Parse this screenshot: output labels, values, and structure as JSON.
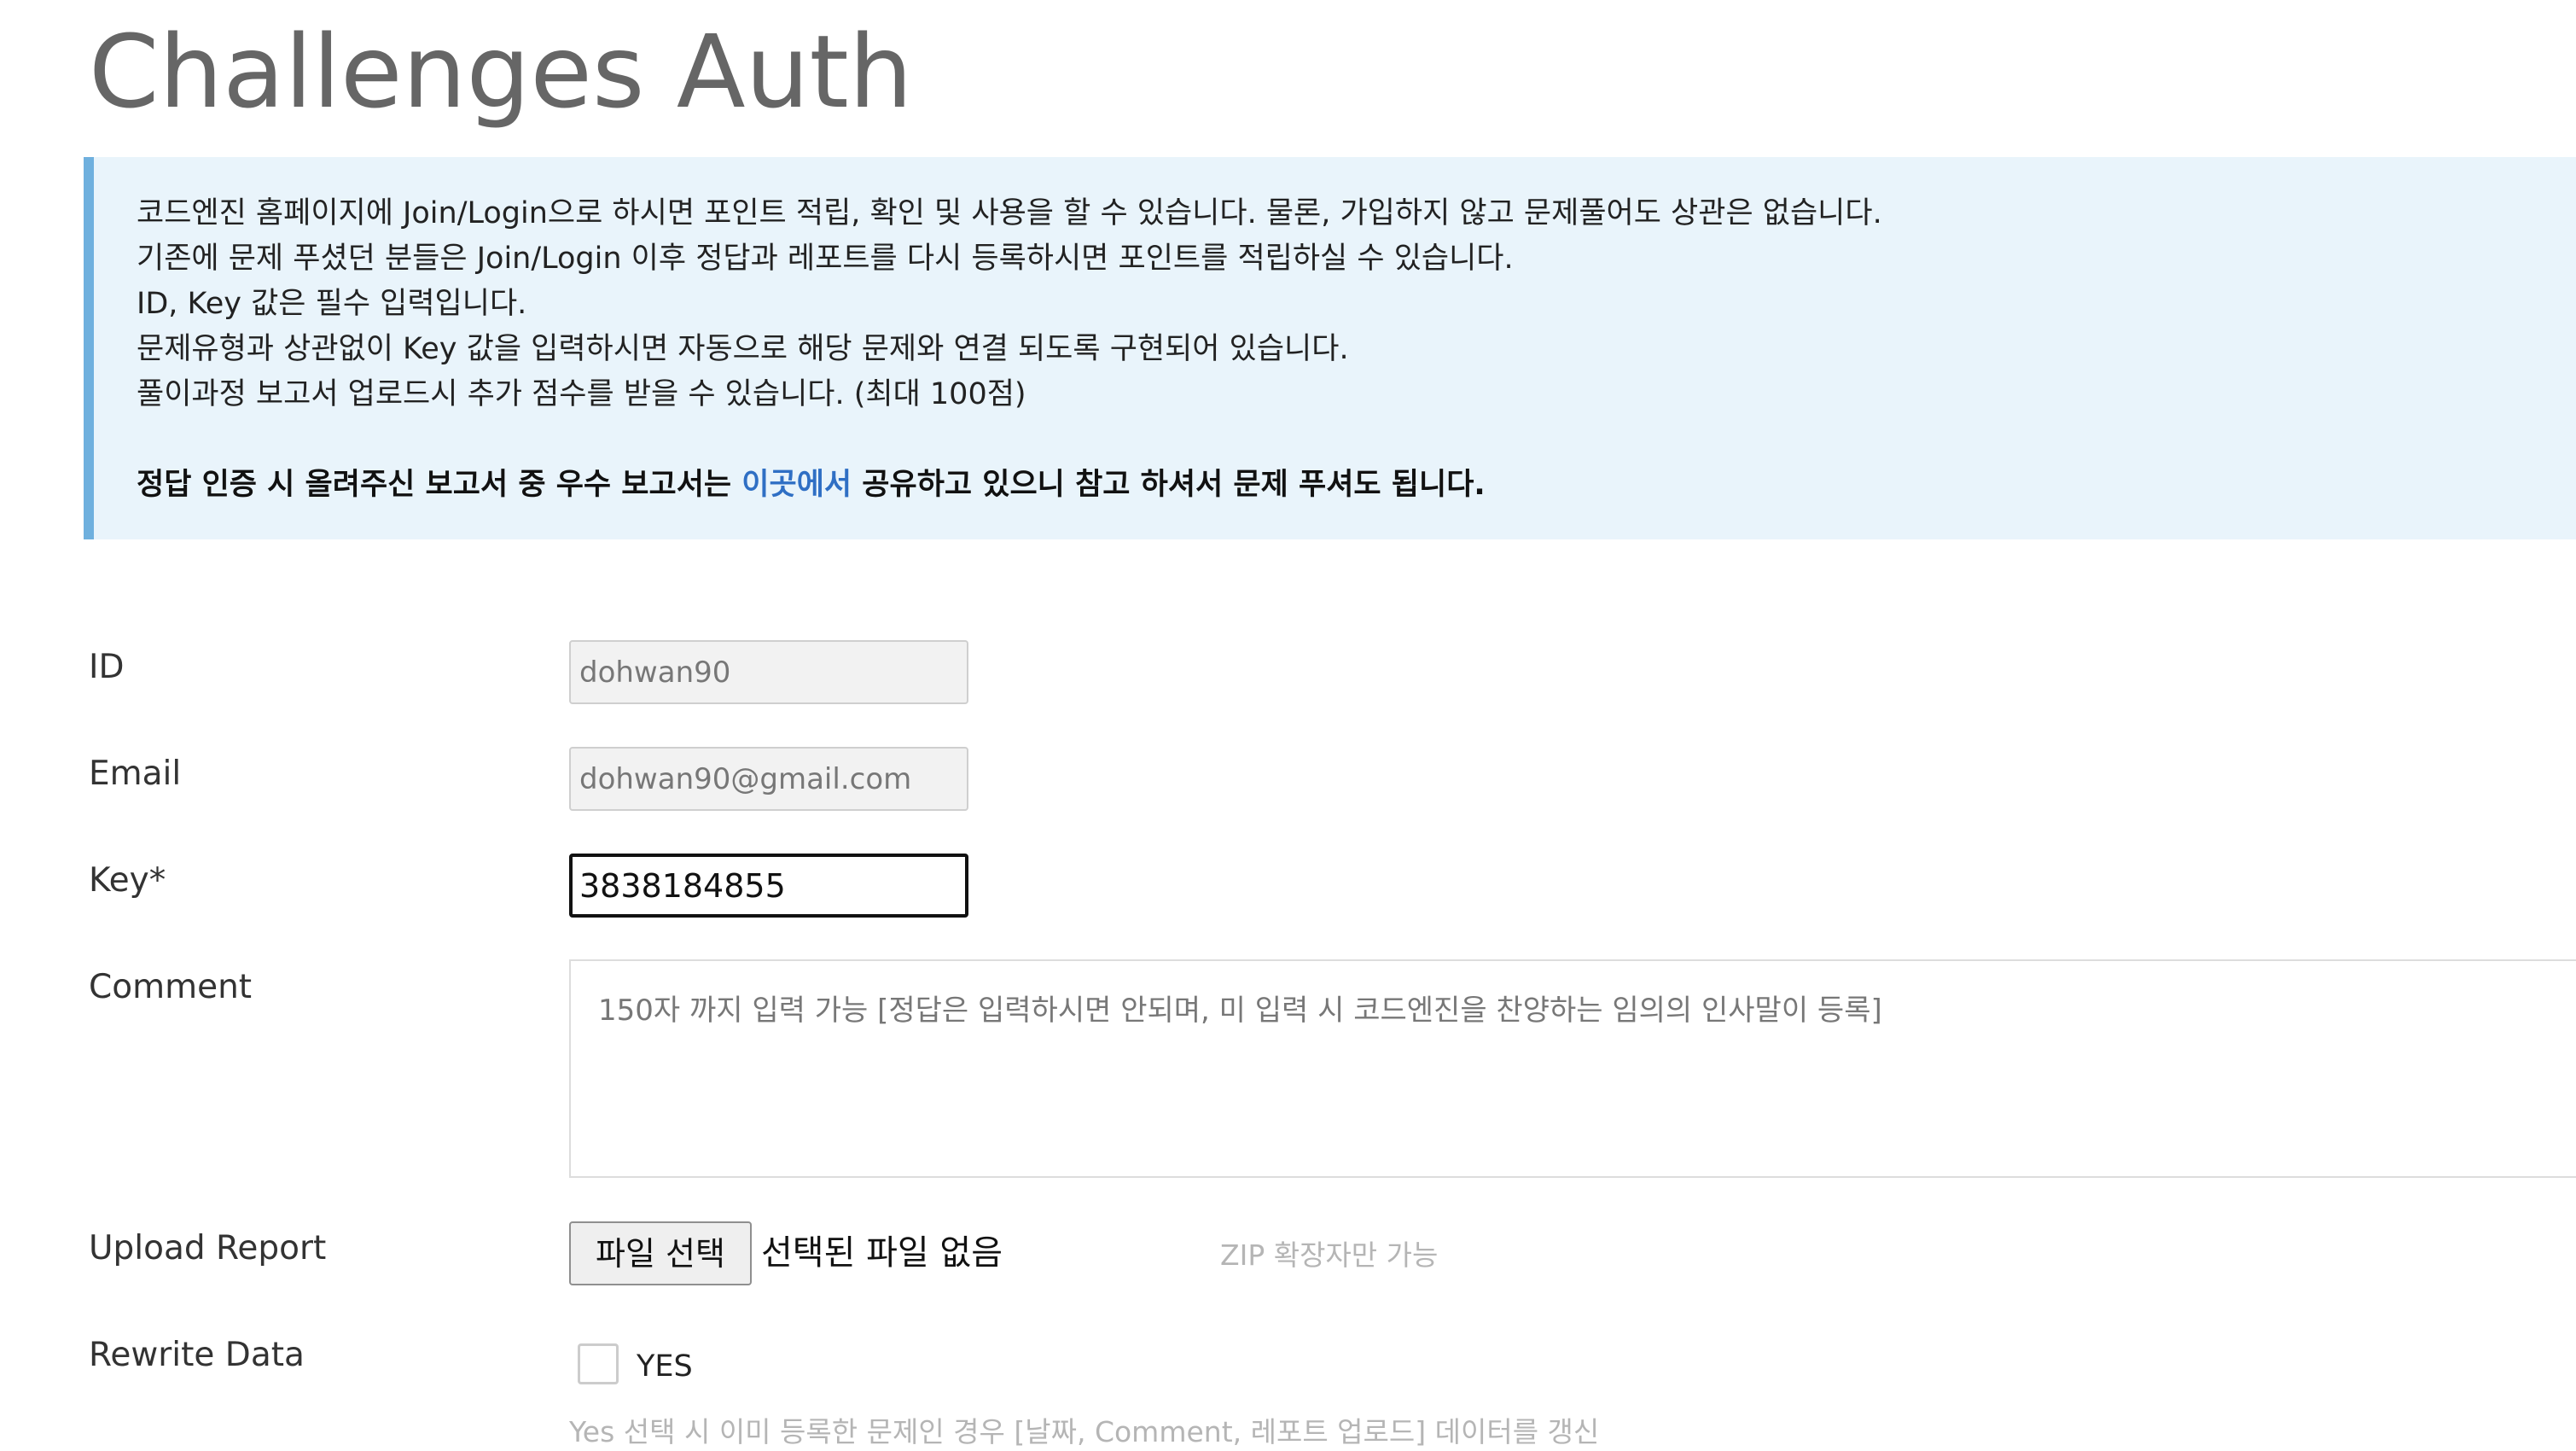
{
  "page": {
    "title": "Challenges Auth"
  },
  "notice": {
    "lines": [
      "코드엔진 홈페이지에 Join/Login으로 하시면 포인트 적립, 확인 및 사용을 할 수 있습니다. 물론, 가입하지 않고 문제풀어도 상관은 없습니다.",
      "기존에 문제 푸셨던 분들은 Join/Login 이후 정답과 레포트를 다시 등록하시면 포인트를 적립하실 수 있습니다.",
      "ID, Key 값은 필수 입력입니다.",
      "문제유형과 상관없이 Key 값을 입력하시면 자동으로 해당 문제와 연결 되도록 구현되어 있습니다.",
      "풀이과정 보고서 업로드시 추가 점수를 받을 수 있습니다. (최대 100점)"
    ],
    "bold_prefix": "정답 인증 시 올려주신 보고서 중 우수 보고서는 ",
    "bold_link": "이곳에서",
    "bold_suffix": " 공유하고 있으니 참고 하셔서 문제 푸셔도 됩니다.",
    "link_color": "#2f6fc4"
  },
  "form": {
    "id": {
      "label": "ID",
      "value": "dohwan90"
    },
    "email": {
      "label": "Email",
      "value": "dohwan90@gmail.com"
    },
    "key": {
      "label": "Key*",
      "value": "3838184855"
    },
    "comment": {
      "label": "Comment",
      "placeholder": "150자 까지 입력 가능 [정답은 입력하시면 안되며, 미 입력 시 코드엔진을 찬양하는 임의의 인사말이 등록]"
    },
    "upload": {
      "label": "Upload Report",
      "button_label": "파일 선택",
      "status": "선택된 파일 없음",
      "hint": "ZIP 확장자만 가능"
    },
    "rewrite": {
      "label": "Rewrite Data",
      "checkbox_label": "YES",
      "checked": false,
      "hint": "Yes 선택 시 이미 등록한 문제인 경우 [날짜, Comment, 레포트 업로드] 데이터를 갱신"
    }
  }
}
